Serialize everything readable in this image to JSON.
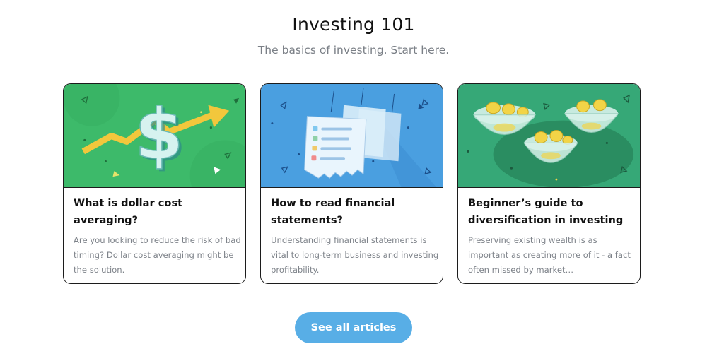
{
  "header": {
    "title": "Investing 101",
    "subtitle": "The basics of investing. Start here."
  },
  "articles": [
    {
      "title": "What is dollar cost averaging?",
      "description": "Are you looking to reduce the risk of bad timing? Dollar cost averaging might be the solution.",
      "image_icon": "dollar-growth-illustration",
      "image_bg": "#3dba6a"
    },
    {
      "title": "How to read financial statements?",
      "description": "Understanding financial statements is vital to long-term business and investing profitability.",
      "image_icon": "financial-statement-illustration",
      "image_bg": "#4a9fe0"
    },
    {
      "title": "Beginner’s guide to diversification in investing",
      "description": "Preserving existing wealth is as important as creating more of it - a fact often missed by market…",
      "image_icon": "coin-bowls-illustration",
      "image_bg": "#2f9a70"
    }
  ],
  "cta": {
    "label": "See all articles",
    "color": "#58aee6"
  }
}
